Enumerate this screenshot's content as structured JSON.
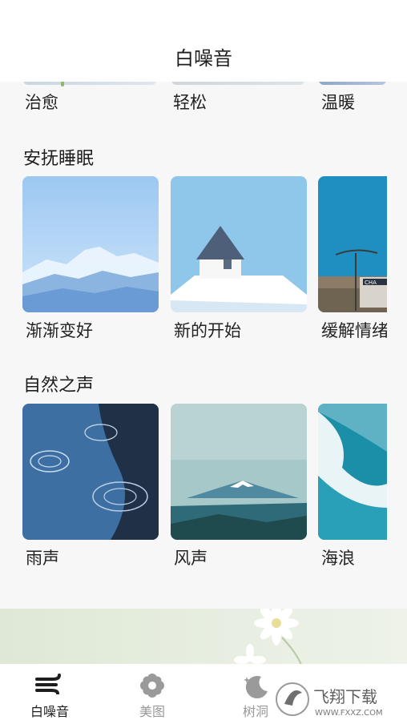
{
  "header": {
    "title": "白噪音"
  },
  "top_row": {
    "labels": [
      "治愈",
      "轻松",
      "温暖"
    ]
  },
  "sections": [
    {
      "title": "安抚睡眠",
      "cards": [
        "渐渐变好",
        "新的开始",
        "缓解情绪"
      ]
    },
    {
      "title": "自然之声",
      "cards": [
        "雨声",
        "风声",
        "海浪"
      ]
    }
  ],
  "tabs": [
    {
      "label": "白噪音",
      "icon": "wind-icon",
      "active": true
    },
    {
      "label": "美图",
      "icon": "flower-icon",
      "active": false
    },
    {
      "label": "树洞",
      "icon": "moon-icon",
      "active": false
    }
  ],
  "watermark": {
    "brand": "飞翔下载",
    "url": "WWW.FXXZ.COM"
  },
  "colors": {
    "active_tab": "#1e1e1e",
    "inactive_tab": "#9a9a9a"
  }
}
